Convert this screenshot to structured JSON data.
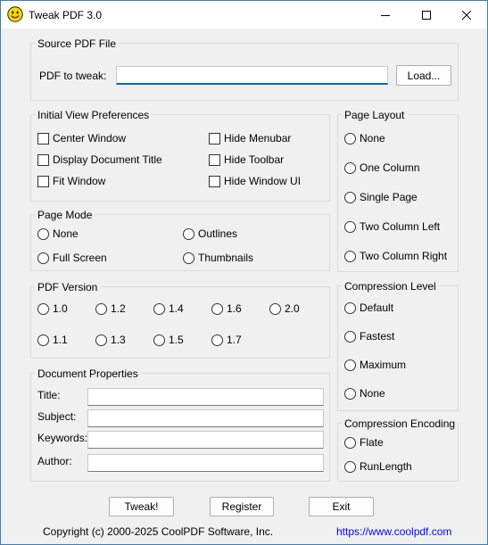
{
  "window": {
    "title": "Tweak PDF 3.0",
    "icon": "smiley-icon",
    "controls": [
      "minimize-icon",
      "maximize-icon",
      "close-icon"
    ]
  },
  "source": {
    "group_title": "Source PDF File",
    "pdf_label": "PDF to tweak:",
    "pdf_value": "",
    "load_label": "Load..."
  },
  "initial_view": {
    "group_title": "Initial View Preferences",
    "options": [
      {
        "label": "Center Window",
        "checked": false
      },
      {
        "label": "Display Document Title",
        "checked": false
      },
      {
        "label": "Fit Window",
        "checked": false
      },
      {
        "label": "Hide Menubar",
        "checked": false
      },
      {
        "label": "Hide Toolbar",
        "checked": false
      },
      {
        "label": "Hide Window UI",
        "checked": false
      }
    ]
  },
  "page_mode": {
    "group_title": "Page Mode",
    "options": [
      "None",
      "Outlines",
      "Full Screen",
      "Thumbnails"
    ],
    "selected": null
  },
  "pdf_version": {
    "group_title": "PDF Version",
    "options": [
      "1.0",
      "1.2",
      "1.4",
      "1.6",
      "2.0",
      "1.1",
      "1.3",
      "1.5",
      "1.7"
    ],
    "selected": null
  },
  "doc_props": {
    "group_title": "Document Properties",
    "fields": [
      {
        "label": "Title:",
        "value": ""
      },
      {
        "label": "Subject:",
        "value": ""
      },
      {
        "label": "Keywords:",
        "value": ""
      },
      {
        "label": "Author:",
        "value": ""
      }
    ]
  },
  "page_layout": {
    "group_title": "Page Layout",
    "options": [
      "None",
      "One Column",
      "Single Page",
      "Two Column Left",
      "Two Column Right"
    ],
    "selected": null
  },
  "compression_level": {
    "group_title": "Compression Level",
    "options": [
      "Default",
      "Fastest",
      "Maximum",
      "None"
    ],
    "selected": null
  },
  "compression_encoding": {
    "group_title": "Compression Encoding",
    "options": [
      "Flate",
      "RunLength"
    ],
    "selected": null
  },
  "buttons": {
    "tweak": "Tweak!",
    "register": "Register",
    "exit": "Exit"
  },
  "footer": {
    "copyright": "Copyright (c) 2000-2025 CoolPDF Software, Inc.",
    "website": "https://www.coolpdf.com"
  },
  "colors": {
    "accent": "#0067c0",
    "link": "#0000ff",
    "background": "#f0f0f0"
  }
}
